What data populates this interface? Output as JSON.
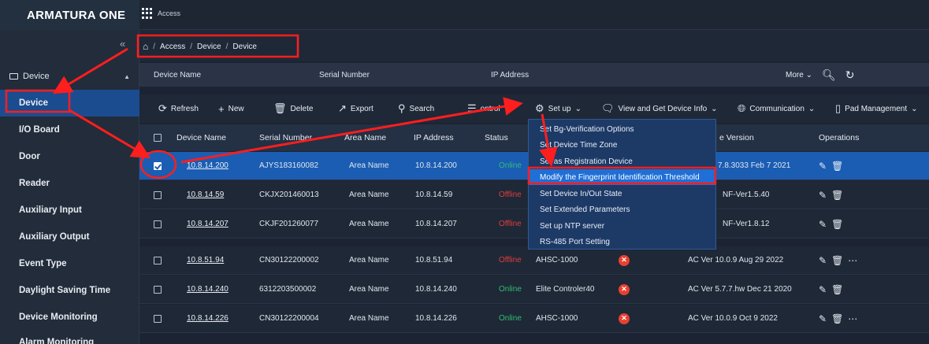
{
  "app": {
    "logo": "ARMATURA ONE",
    "module": "Access"
  },
  "breadcrumb": {
    "items": [
      "Access",
      "Device",
      "Device"
    ],
    "sep": "/"
  },
  "sidebar": {
    "collapse": "«",
    "group": "Device",
    "items": [
      "Device",
      "I/O Board",
      "Door",
      "Reader",
      "Auxiliary Input",
      "Auxiliary Output",
      "Event Type",
      "Daylight Saving Time",
      "Device Monitoring",
      "Alarm Monitoring"
    ]
  },
  "filters": {
    "device_name": "Device Name",
    "serial_number": "Serial Number",
    "ip_address": "IP Address",
    "more": "More"
  },
  "toolbar": {
    "refresh": "Refresh",
    "new": "New",
    "delete": "Delete",
    "export": "Export",
    "search": "Search",
    "control_partial": "ontrol",
    "setup": "Set up",
    "view_info": "View and Get Device Info",
    "communication": "Communication",
    "pad": "Pad Management"
  },
  "table": {
    "headers": {
      "name": "Device Name",
      "serial": "Serial Number",
      "area": "Area Name",
      "ip": "IP Address",
      "status": "Status",
      "version": "e Version",
      "ops": "Operations"
    },
    "rows": [
      {
        "name": "10.8.14.200",
        "serial": "AJYS183160082",
        "area": "Area Name",
        "ip": "10.8.14.200",
        "status": "Online",
        "model": "",
        "version": "7.8.3033 Feb 7 2021"
      },
      {
        "name": "10.8.14.59",
        "serial": "CKJX201460013",
        "area": "Area Name",
        "ip": "10.8.14.59",
        "status": "Offline",
        "model": "",
        "version": "NF-Ver1.5.40"
      },
      {
        "name": "10.8.14.207",
        "serial": "CKJF201260077",
        "area": "Area Name",
        "ip": "10.8.14.207",
        "status": "Offline",
        "model": "",
        "version": "NF-Ver1.8.12"
      },
      {
        "name": "10.8.51.94",
        "serial": "CN30122200002",
        "area": "Area Name",
        "ip": "10.8.51.94",
        "status": "Offline",
        "model": "AHSC-1000",
        "version": "AC Ver 10.0.9 Aug 29 2022"
      },
      {
        "name": "10.8.14.240",
        "serial": "6312203500002",
        "area": "Area Name",
        "ip": "10.8.14.240",
        "status": "Online",
        "model": "Elite Controler40",
        "version": "AC Ver 5.7.7.hw Dec 21 2020"
      },
      {
        "name": "10.8.14.226",
        "serial": "CN30122200004",
        "area": "Area Name",
        "ip": "10.8.14.226",
        "status": "Online",
        "model": "AHSC-1000",
        "version": "AC Ver 10.0.9 Oct 9 2022"
      }
    ]
  },
  "setup_menu": {
    "items": [
      "Set Bg-Verification Options",
      "Set Device Time Zone",
      "Set as Registration Device",
      "Modify the Fingerprint Identification Threshold",
      "Set Device In/Out State",
      "Set Extended Parameters",
      "Set up NTP server",
      "RS-485 Port Setting"
    ],
    "highlighted_index": 3
  },
  "colors": {
    "accent": "#1a5db3",
    "annotation": "#ff1e1e",
    "online": "#2fbf71",
    "offline": "#e23d3d"
  }
}
